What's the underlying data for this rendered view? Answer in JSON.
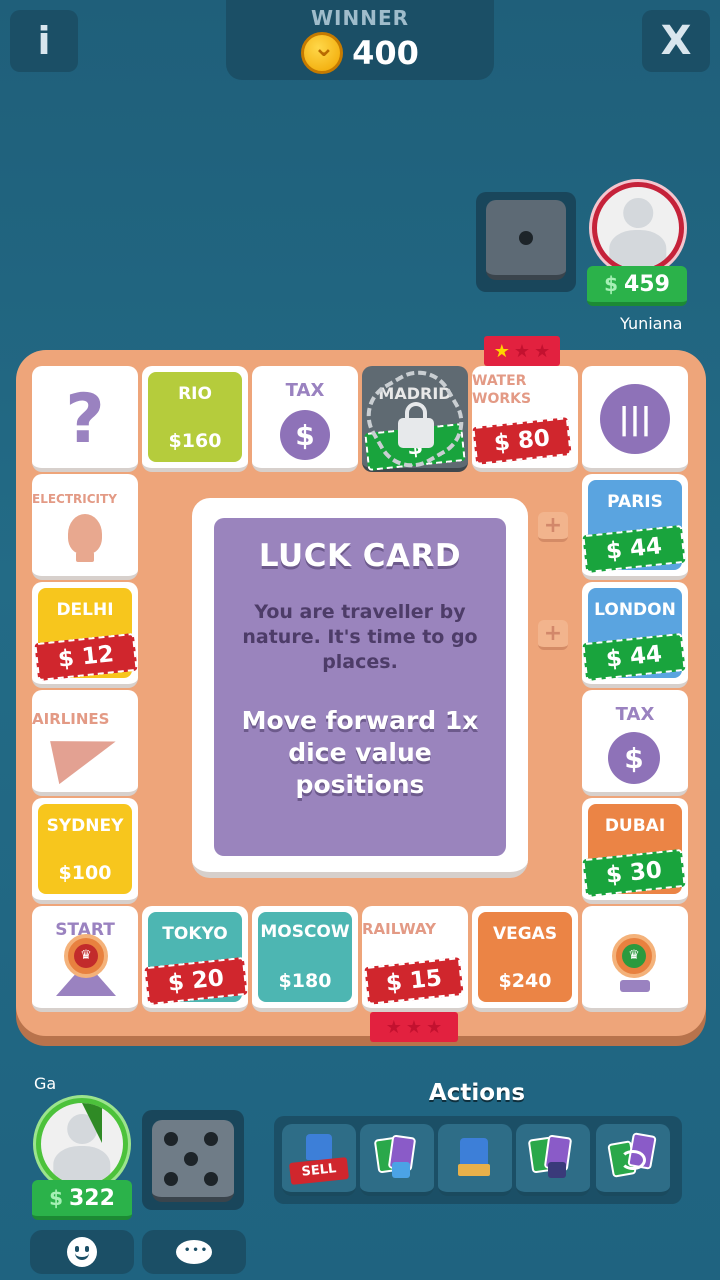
{
  "header": {
    "info_button": "i",
    "close_button": "X",
    "winner_label": "WINNER",
    "winner_prize": "400"
  },
  "opponent": {
    "name": "Yuniana",
    "cash": "459",
    "dice_value": 1
  },
  "player": {
    "name": "Ga",
    "cash": "322",
    "dice_value": 5,
    "turn_timer_fraction": 0.1
  },
  "board": {
    "top_row": [
      {
        "type": "chance",
        "label": "?"
      },
      {
        "name": "RIO",
        "price": "$160",
        "color": "#b5cc3c"
      },
      {
        "name": "TAX",
        "icon": "dollar-icon"
      },
      {
        "name": "MADRID",
        "price": "$",
        "locked": true
      },
      {
        "name": "WATER WORKS",
        "price": "80",
        "rank_stars": 1
      },
      {
        "type": "jail",
        "icon": "jail-icon"
      }
    ],
    "left_col": [
      {
        "name": "ELECTRICITY",
        "icon": "bulb-icon"
      },
      {
        "name": "DELHI",
        "price": "12",
        "color": "#f7c61d"
      },
      {
        "name": "AIRLINES",
        "icon": "plane-icon"
      },
      {
        "name": "SYDNEY",
        "price": "$100",
        "color": "#f7c61d"
      }
    ],
    "right_col": [
      {
        "name": "PARIS",
        "price": "44",
        "color": "#5aa4e0"
      },
      {
        "name": "LONDON",
        "price": "44",
        "color": "#5aa4e0"
      },
      {
        "name": "TAX",
        "icon": "dollar-icon"
      },
      {
        "name": "DUBAI",
        "price": "30",
        "color": "#eb8445"
      }
    ],
    "bottom_row": [
      {
        "name": "START"
      },
      {
        "name": "TOKYO",
        "price": "20",
        "color": "#4db6b2"
      },
      {
        "name": "MOSCOW",
        "price": "$180",
        "color": "#4db6b2"
      },
      {
        "name": "RAILWAY",
        "price": "15",
        "rank_stars": 0
      },
      {
        "name": "VEGAS",
        "price": "$240",
        "color": "#eb8445"
      },
      {
        "type": "corner"
      }
    ],
    "plus_symbol": "+",
    "dollar_symbol": "$"
  },
  "luck_card": {
    "title": "LUCK CARD",
    "text": "You are traveller by nature. It's time to go places.",
    "action": "Move forward 1x dice value positions"
  },
  "actions": {
    "title": "Actions",
    "sell_label": "SELL",
    "buttons": [
      "sell-house",
      "mortgage-card",
      "build-house",
      "lock-card",
      "trade-card"
    ]
  },
  "colors": {
    "board": "#eea57a",
    "cash_green": "#2bb24a",
    "ticket_red": "#d0262d",
    "card_purple": "#9a84bd"
  }
}
